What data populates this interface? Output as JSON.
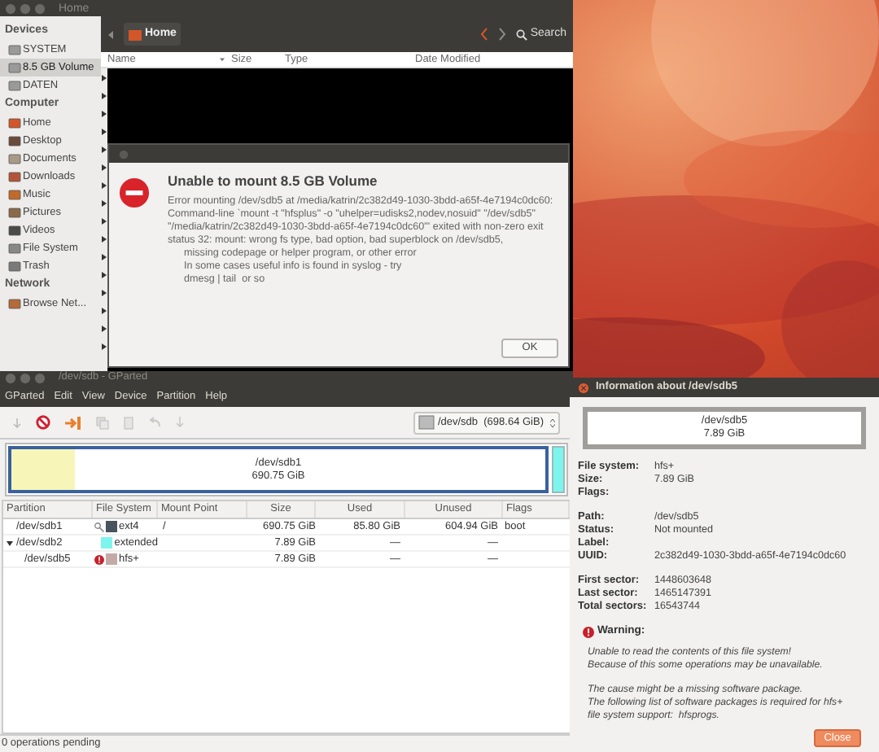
{
  "file_manager": {
    "title": "Home",
    "location": "Home",
    "search": "Search",
    "sidebar": [
      {
        "heading": "Devices",
        "items": [
          {
            "label": "SYSTEM",
            "kind": "drive",
            "selected": false
          },
          {
            "label": "8.5 GB Volume",
            "kind": "drive",
            "selected": true
          },
          {
            "label": "DATEN",
            "kind": "drive",
            "selected": false
          }
        ]
      },
      {
        "heading": "Computer",
        "items": [
          {
            "label": "Home",
            "kind": "home",
            "selected": false
          },
          {
            "label": "Desktop",
            "kind": "desktop",
            "selected": false
          },
          {
            "label": "Documents",
            "kind": "documents",
            "selected": false
          },
          {
            "label": "Downloads",
            "kind": "downloads",
            "selected": false
          },
          {
            "label": "Music",
            "kind": "music",
            "selected": false
          },
          {
            "label": "Pictures",
            "kind": "pictures",
            "selected": false
          },
          {
            "label": "Videos",
            "kind": "videos",
            "selected": false
          },
          {
            "label": "File System",
            "kind": "filesystem",
            "selected": false
          },
          {
            "label": "Trash",
            "kind": "trash",
            "selected": false
          }
        ]
      },
      {
        "heading": "Network",
        "items": [
          {
            "label": "Browse Net...",
            "kind": "network",
            "selected": false
          }
        ]
      }
    ],
    "columns": [
      "Name",
      "Size",
      "Type",
      "Date Modified"
    ]
  },
  "error_dialog": {
    "title": "Unable to mount 8.5 GB Volume",
    "message": "Error mounting /dev/sdb5 at /media/katrin/2c382d49-1030-3bdd-a65f-4e7194c0dc60: Command-line `mount -t \"hfsplus\" -o \"uhelper=udisks2,nodev,nosuid\" \"/dev/sdb5\" \"/media/katrin/2c382d49-1030-3bdd-a65f-4e7194c0dc60\"' exited with non-zero exit status 32: mount: wrong fs type, bad option, bad superblock on /dev/sdb5,",
    "details": [
      "missing codepage or helper program, or other error",
      "In some cases useful info is found in syslog - try",
      "dmesg | tail  or so"
    ],
    "button": "OK"
  },
  "gparted": {
    "title": "/dev/sdb - GParted",
    "menu": [
      "GParted",
      "Edit",
      "View",
      "Device",
      "Partition",
      "Help"
    ],
    "device": "/dev/sdb  (698.64 GiB)",
    "graph": {
      "name": "/dev/sdb1",
      "size": "690.75 GiB",
      "level": 0.12
    },
    "columns": [
      "Partition",
      "File System",
      "Mount Point",
      "Size",
      "Used",
      "Unused",
      "Flags"
    ],
    "rows": [
      {
        "partition": "/dev/sdb1",
        "kind": "mounted",
        "file_system": "ext4",
        "color": "#48535e",
        "mount_point": "/",
        "size": "690.75 GiB",
        "used": "85.80 GiB",
        "unused": "604.94 GiB",
        "flags": "boot"
      },
      {
        "partition": "/dev/sdb2",
        "kind": "plain",
        "file_system": "extended",
        "color": "#7ef5ec",
        "size": "7.89 GiB",
        "used": "—",
        "unused": "—",
        "expanded": true,
        "children": [
          {
            "partition": "/dev/sdb5",
            "kind": "warning",
            "file_system": "hfs+",
            "color": "#c4aaa6",
            "size": "7.89 GiB",
            "used": "—",
            "unused": "—"
          }
        ]
      }
    ],
    "status": "0 operations pending"
  },
  "info_dialog": {
    "title": "Information about /dev/sdb5",
    "partition": "/dev/sdb5",
    "size": "7.89 GiB",
    "groups": [
      [
        {
          "label": "File system:",
          "value": "hfs+"
        },
        {
          "label": "Size:",
          "value": "7.89 GiB"
        },
        {
          "label": "Flags:"
        }
      ],
      [
        {
          "label": "Path:",
          "value": "/dev/sdb5"
        },
        {
          "label": "Status:",
          "value": "Not mounted"
        },
        {
          "label": "Label:"
        },
        {
          "label": "UUID:",
          "value": "2c382d49-1030-3bdd-a65f-4e7194c0dc60"
        }
      ],
      [
        {
          "label": "First sector:",
          "value": "1448603648"
        },
        {
          "label": "Last sector:",
          "value": "1465147391"
        },
        {
          "label": "Total sectors:",
          "value": "16543744"
        }
      ]
    ],
    "warning": {
      "heading": "Warning:",
      "paragraphs": [
        [
          "Unable to read the contents of this file system!",
          "Because of this some operations may be unavailable."
        ],
        [
          "The cause might be a missing software package.",
          "The following list of software packages is required for hfs+",
          "file system support:  hfsprogs."
        ]
      ]
    },
    "button": "Close"
  }
}
